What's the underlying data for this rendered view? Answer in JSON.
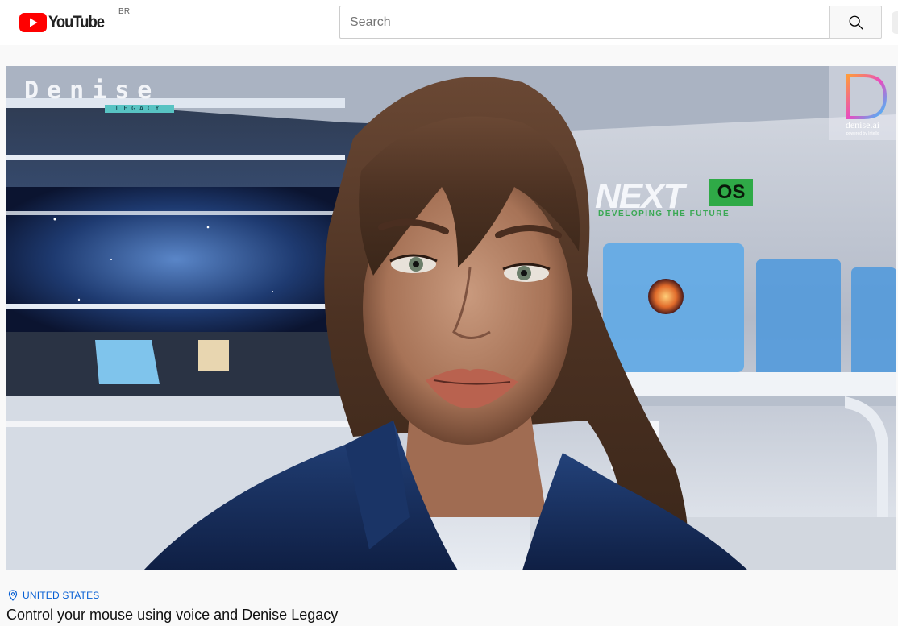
{
  "header": {
    "logo_text": "YouTube",
    "logo_country": "BR",
    "search_placeholder": "Search",
    "search_icon": "search-icon"
  },
  "video": {
    "brand_logo_main": "Denise",
    "brand_logo_sub": "LEGACY",
    "corner_logo_text": "denise.ai",
    "corner_logo_sub": "powered by Intellx",
    "wall_sign_main": "NEXT",
    "wall_sign_badge": "OS",
    "wall_sign_sub": "DEVELOPING THE FUTURE"
  },
  "info": {
    "location": "UNITED STATES",
    "location_icon": "location-pin-icon",
    "title": "Control your mouse using voice and Denise Legacy"
  },
  "colors": {
    "youtube_red": "#ff0000",
    "link_blue": "#065fd4",
    "brand_teal": "#58c3c3",
    "os_green": "#2faa47"
  }
}
